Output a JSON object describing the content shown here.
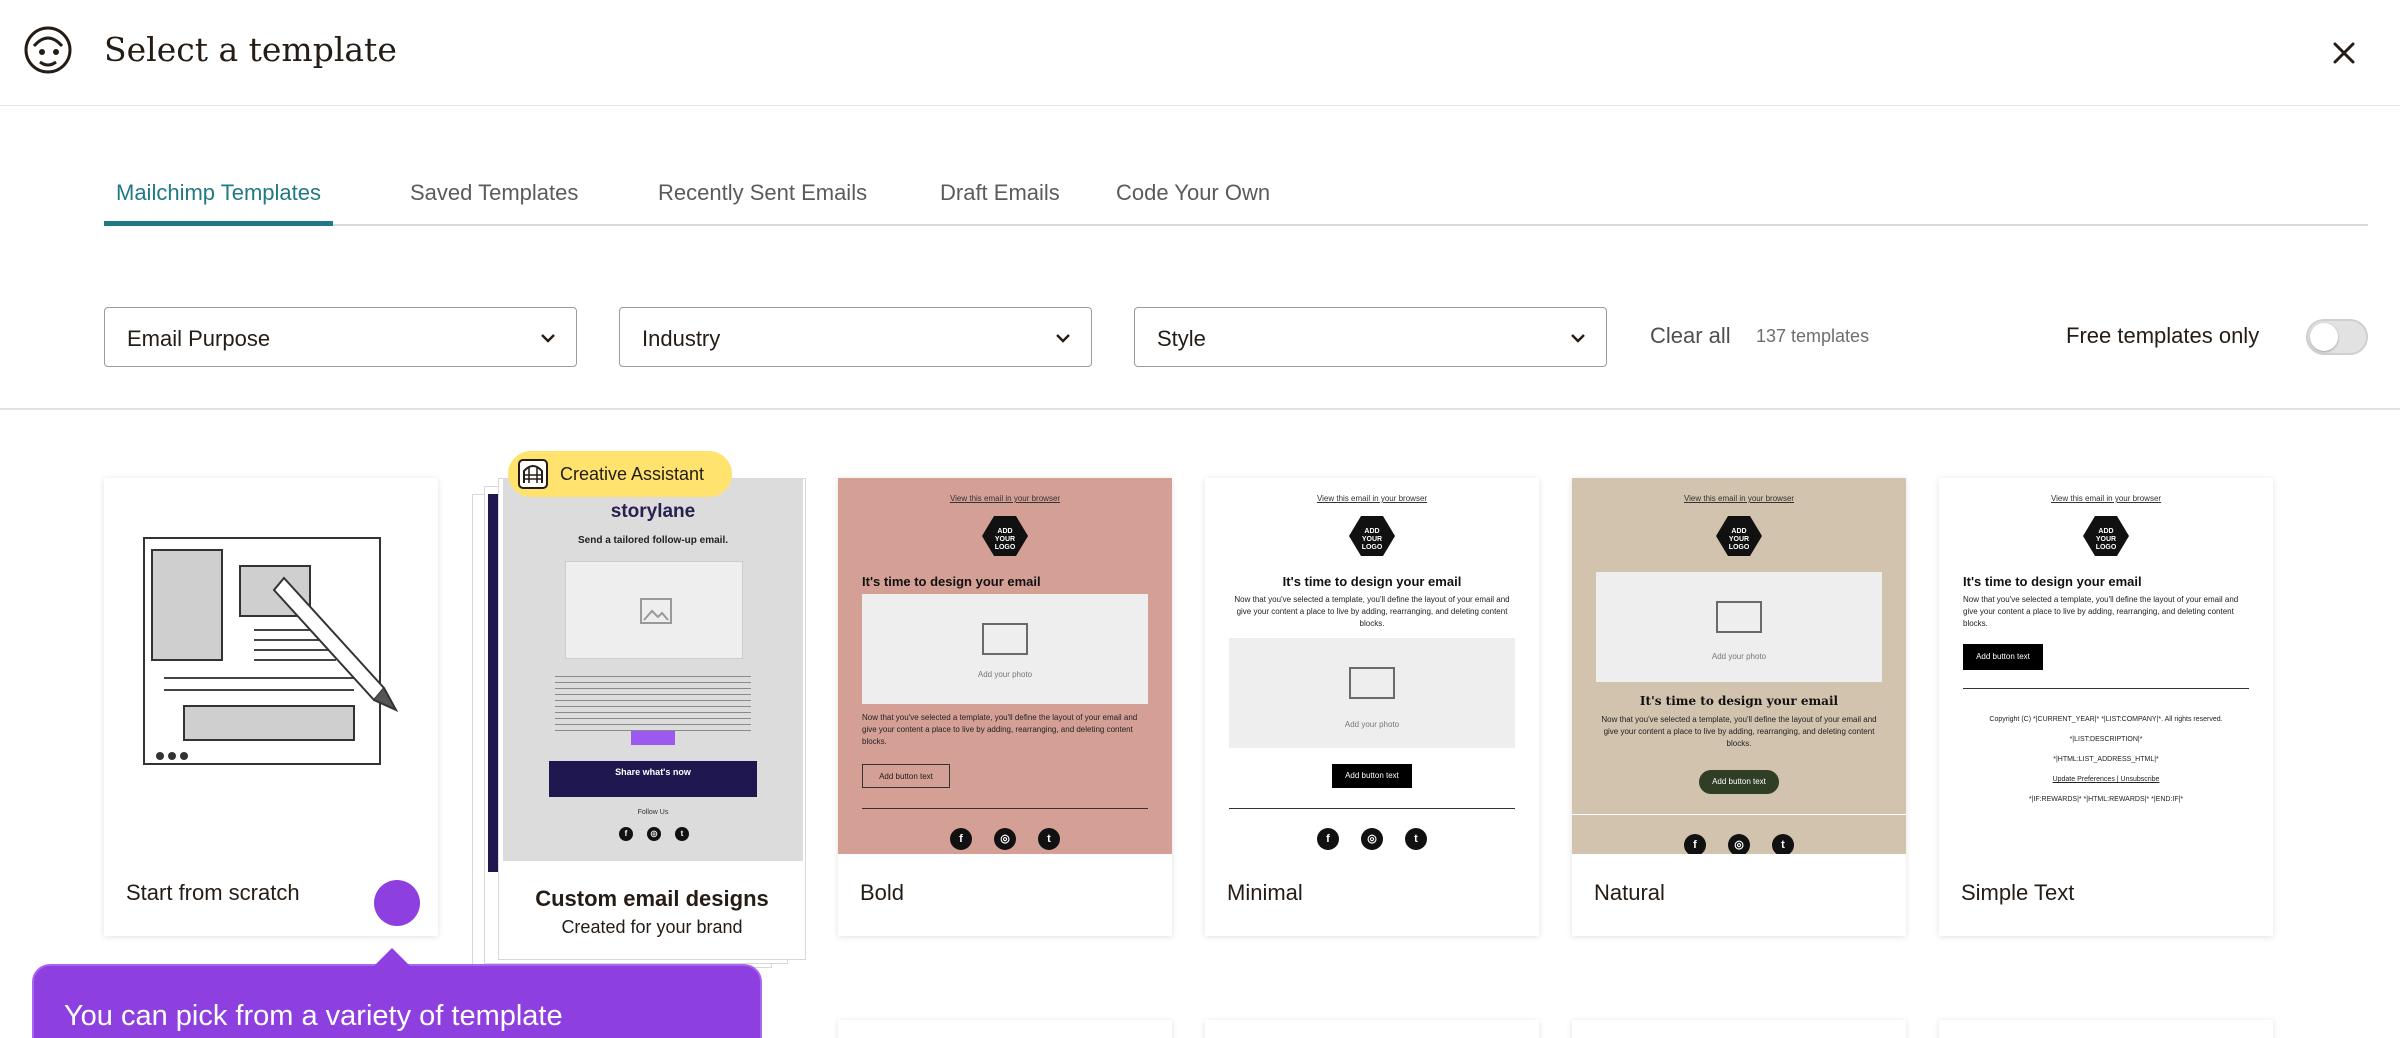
{
  "header": {
    "title": "Select a template"
  },
  "tabs": [
    {
      "label": "Mailchimp Templates",
      "active": true
    },
    {
      "label": "Saved Templates"
    },
    {
      "label": "Recently Sent Emails"
    },
    {
      "label": "Draft Emails"
    },
    {
      "label": "Code Your Own"
    }
  ],
  "filters": {
    "purpose": "Email Purpose",
    "industry": "Industry",
    "style": "Style",
    "clear_all": "Clear all",
    "count": "137 templates",
    "free_only": "Free templates only",
    "free_only_on": false
  },
  "cards": {
    "scratch": "Start from scratch",
    "custom": {
      "badge": "Creative Assistant",
      "title": "Custom email designs",
      "subtitle": "Created for your brand",
      "brand": "storylane",
      "headline": "Send a tailored follow-up email.",
      "button": "Share what's now",
      "follow": "Follow Us"
    },
    "bold": "Bold",
    "minimal": "Minimal",
    "natural": "Natural",
    "simple_text": "Simple Text"
  },
  "template_preview": {
    "view_link": "View this email in your browser",
    "logo": "ADD YOUR LOGO",
    "heading": "It's time to design your email",
    "body": "Now that you've selected a template, you'll define the layout of your email and give your content a place to live by adding, rearranging, and deleting content blocks.",
    "photo": "Add your photo",
    "button": "Add button text",
    "footer_lines": [
      "Copyright (C) *|CURRENT_YEAR|* *|LIST:COMPANY|*. All rights reserved.",
      "*|LIST:DESCRIPTION|*",
      "*|HTML:LIST_ADDRESS_HTML|*",
      "Update Preferences | Unsubscribe",
      "*|IF:REWARDS|* *|HTML:REWARDS|* *|END:IF|*"
    ]
  },
  "colors": {
    "accent": "#1f7a84",
    "bold_bg": "#d4a096",
    "natural_bg": "#d2c3ae",
    "natural_button": "#2f3e25",
    "tooltip": "#8e3fe0",
    "badge": "#ffe36e"
  },
  "tooltip": {
    "text": "You can pick from a variety of template"
  }
}
